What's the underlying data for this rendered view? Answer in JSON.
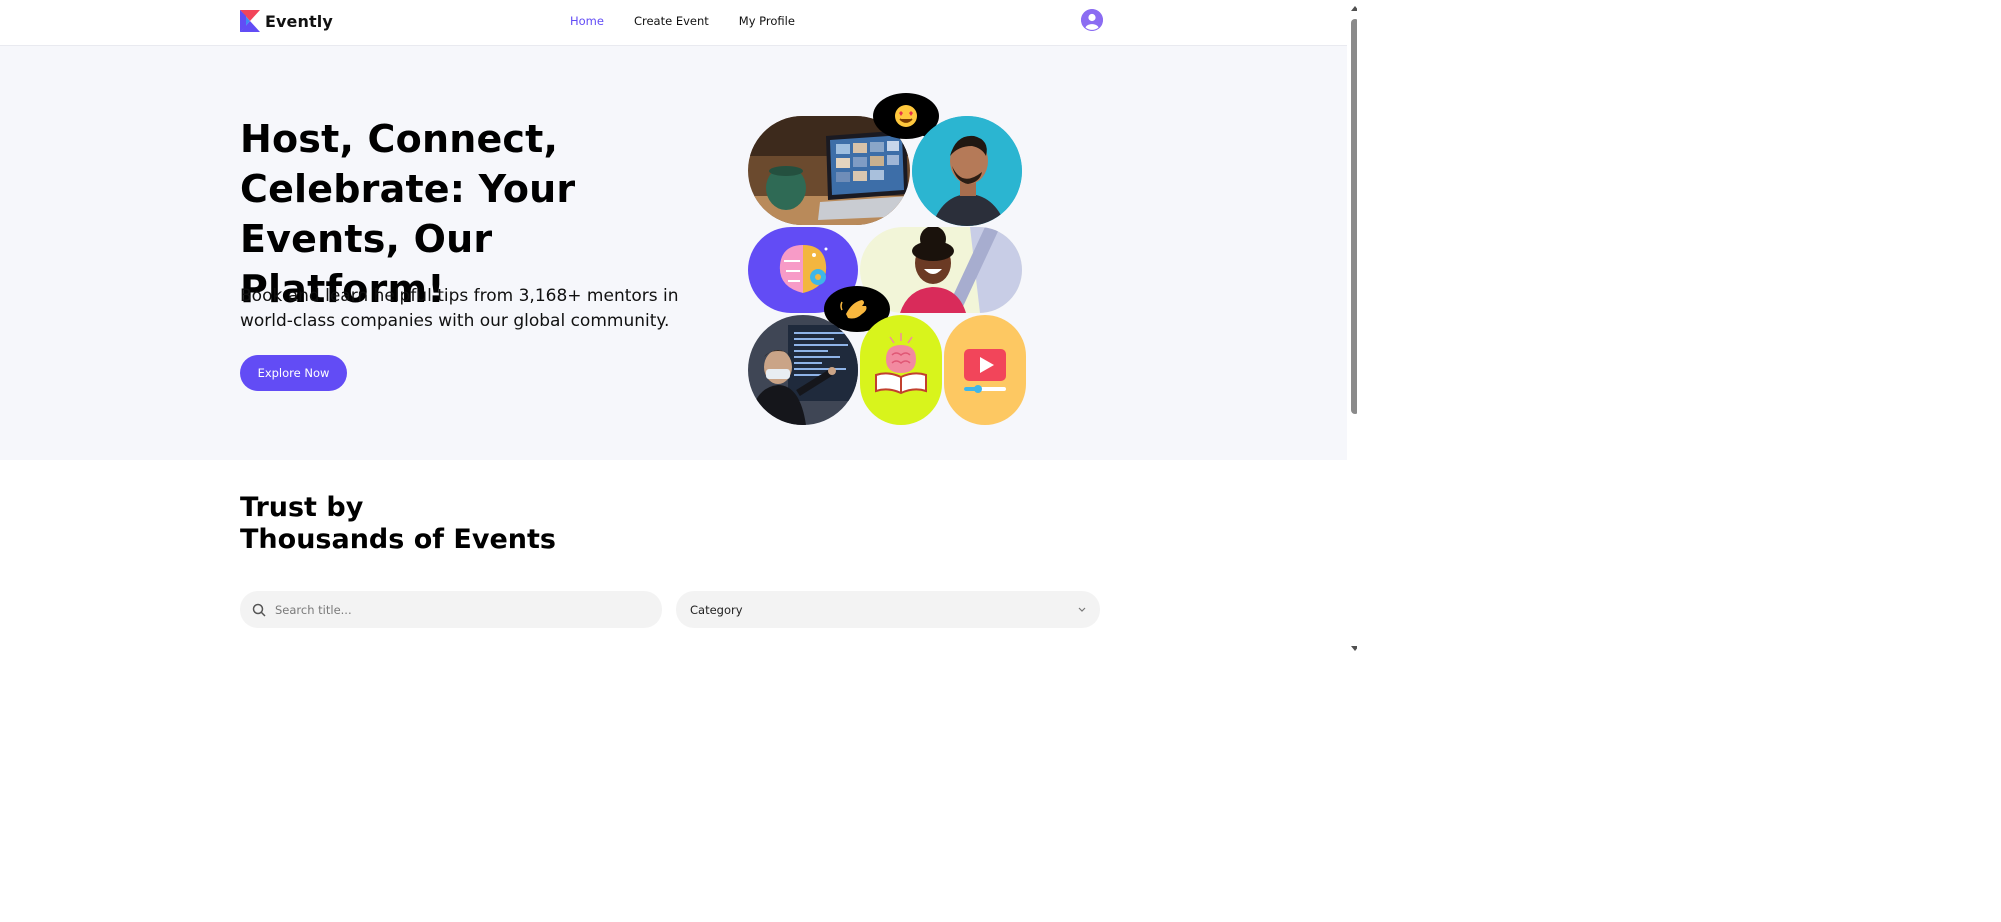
{
  "header": {
    "logo_text": "Evently",
    "nav": [
      "Home",
      "Create Event",
      "My Profile"
    ],
    "active_nav": "Home"
  },
  "hero": {
    "title": "Host, Connect, Celebrate: Your Events, Our Platform!",
    "subtitle": "Book and learn helpful tips from 3,168+ mentors in world-class companies with our global community.",
    "cta_label": "Explore Now"
  },
  "section": {
    "title_line1": "Trust by",
    "title_line2": "Thousands of Events"
  },
  "search": {
    "placeholder": "Search title..."
  },
  "category": {
    "selected": "Category"
  },
  "icons": {
    "search": "search-icon",
    "chevron": "chevron-down-icon",
    "avatar": "user-avatar-icon"
  },
  "colors": {
    "accent": "#624cf5",
    "hero_bg": "#f6f7fb",
    "input_bg": "#f3f3f3"
  }
}
